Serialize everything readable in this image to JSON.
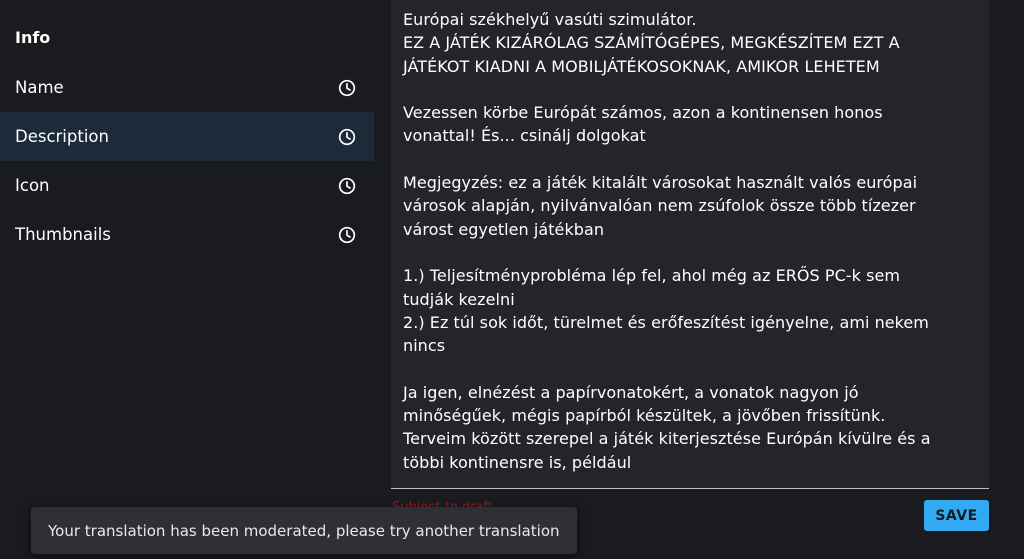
{
  "sidebar": {
    "header": "Info",
    "items": [
      {
        "label": "Name",
        "icon": "clock-icon"
      },
      {
        "label": "Description",
        "icon": "clock-icon",
        "active": true
      },
      {
        "label": "Icon",
        "icon": "clock-icon"
      },
      {
        "label": "Thumbnails",
        "icon": "clock-icon"
      }
    ]
  },
  "description": {
    "lines": [
      "Európai székhelyű vasúti szimulátor.",
      "EZ A JÁTÉK KIZÁRÓLAG SZÁMÍTÓGÉPES, MEGKÉSZÍTEM EZT A",
      "JÁTÉKOT KIADNI A MOBILJÁTÉKOSOKNAK, AMIKOR LEHETEM",
      "",
      "Vezessen körbe Európát számos, azon a kontinensen honos",
      "vonattal! És... csinálj dolgokat",
      "",
      "Megjegyzés: ez a játék kitalált városokat használt valós európai",
      "városok alapján, nyilvánvalóan nem zsúfolok össze több tízezer",
      "várost egyetlen játékban",
      "",
      "1.) Teljesítményprobléma lép fel, ahol még az ERŐS PC-k sem",
      "tudják kezelni",
      "2.) Ez túl sok időt, türelmet és erőfeszítést igényelne, ami nekem",
      "nincs",
      "",
      "Ja igen, elnézést a papírvonatokért, a vonatok nagyon jó",
      "minőségűek, mégis papírból készültek, a jövőben frissítünk.",
      "Terveim között szerepel a játék kiterjesztése Európán kívülre és a",
      "többi kontinensre is, például"
    ]
  },
  "footer": {
    "save_label": "SAVE",
    "error_text": "Subject to draft"
  },
  "toast": {
    "message": "Your translation has been moderated, please try another translation"
  },
  "colors": {
    "background": "#191b1f",
    "active_item": "#1c2a3a",
    "save_button": "#33a9f2",
    "spellcheck_underline": "#d0202a"
  }
}
